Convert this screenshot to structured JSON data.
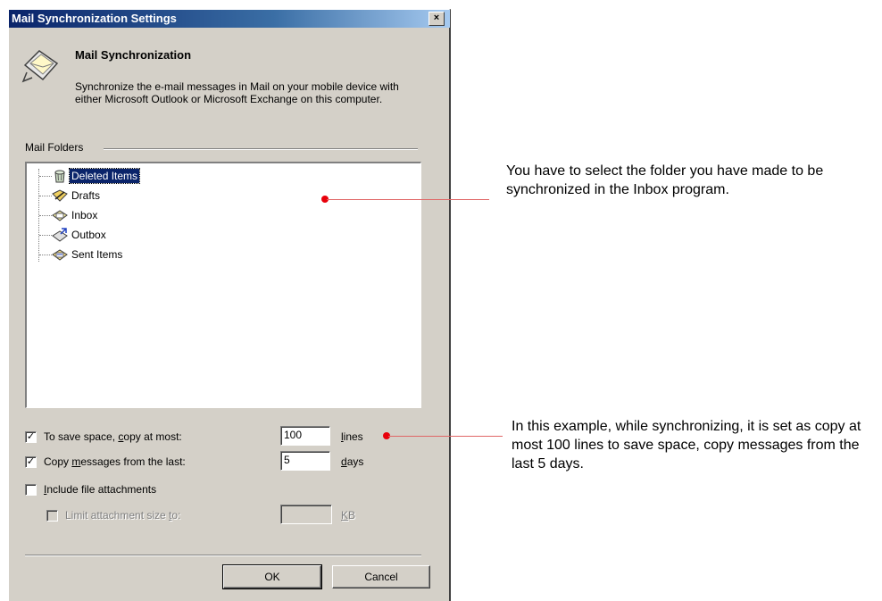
{
  "window": {
    "title": "Mail Synchronization Settings",
    "close_glyph": "×"
  },
  "header": {
    "title": "Mail Synchronization",
    "description": "Synchronize the e-mail messages in Mail on your mobile device with either Microsoft Outlook or Microsoft Exchange on this computer.",
    "icon": "mail-sync-icon"
  },
  "folders": {
    "group_label": "Mail Folders",
    "items": [
      {
        "label": "Deleted Items",
        "icon": "trash-icon",
        "selected": true
      },
      {
        "label": "Drafts",
        "icon": "drafts-icon",
        "selected": false
      },
      {
        "label": "Inbox",
        "icon": "inbox-icon",
        "selected": false
      },
      {
        "label": "Outbox",
        "icon": "outbox-icon",
        "selected": false
      },
      {
        "label": "Sent Items",
        "icon": "sent-items-icon",
        "selected": false
      }
    ]
  },
  "options": {
    "copy_at_most": {
      "label_pre": "To save space, ",
      "label_u": "c",
      "label_post": "opy at most:",
      "checked": true,
      "value": "100",
      "unit_u": "l",
      "unit_rest": "ines"
    },
    "copy_from_last": {
      "label_pre": "Copy ",
      "label_u": "m",
      "label_post": "essages from the last:",
      "checked": true,
      "value": "5",
      "unit_u": "d",
      "unit_rest": "ays"
    },
    "include_attachments": {
      "label_pre": "",
      "label_u": "I",
      "label_post": "nclude file attachments",
      "checked": false
    },
    "limit_attachment": {
      "label_pre": "Limit attachment size ",
      "label_u": "t",
      "label_post": "o:",
      "checked": false,
      "value": "",
      "unit_u": "K",
      "unit_rest": "B"
    }
  },
  "buttons": {
    "ok": "OK",
    "cancel": "Cancel"
  },
  "callouts": {
    "folders": "You have to select the folder you have made to be synchronized in the Inbox program.",
    "options": "In this example, while synchronizing, it is set as copy at most 100 lines to save space, copy messages from the last 5 days."
  },
  "colors": {
    "title_bar": "#0a246a",
    "selection": "#0a246a",
    "annotation": "#e8000b"
  }
}
